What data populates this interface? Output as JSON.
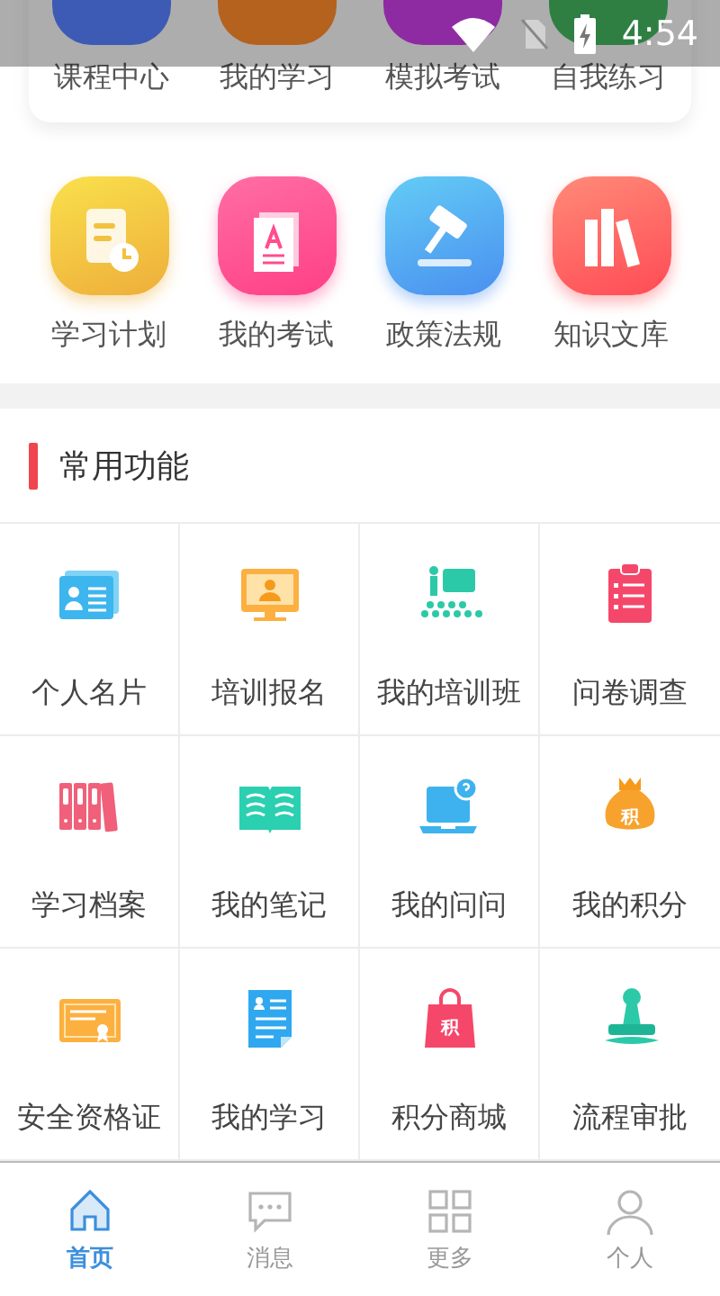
{
  "status_bar": {
    "time": "4:54"
  },
  "top_shortcuts": [
    {
      "label": "课程中心",
      "color": "#3d5bb5"
    },
    {
      "label": "我的学习",
      "color": "#b5621f"
    },
    {
      "label": "模拟考试",
      "color": "#8e2ba3"
    },
    {
      "label": "自我练习",
      "color": "#2f7f43"
    }
  ],
  "shortcuts": [
    {
      "label": "学习计划",
      "kind": "plan"
    },
    {
      "label": "我的考试",
      "kind": "exam"
    },
    {
      "label": "政策法规",
      "kind": "law"
    },
    {
      "label": "知识文库",
      "kind": "library"
    }
  ],
  "section": {
    "title": "常用功能"
  },
  "functions": [
    {
      "label": "个人名片",
      "kind": "card"
    },
    {
      "label": "培训报名",
      "kind": "monitor"
    },
    {
      "label": "我的培训班",
      "kind": "class"
    },
    {
      "label": "问卷调查",
      "kind": "survey"
    },
    {
      "label": "学习档案",
      "kind": "archive"
    },
    {
      "label": "我的笔记",
      "kind": "notes"
    },
    {
      "label": "我的问问",
      "kind": "qa"
    },
    {
      "label": "我的积分",
      "kind": "bag",
      "icon_text": "积"
    },
    {
      "label": "安全资格证",
      "kind": "certificate"
    },
    {
      "label": "我的学习",
      "kind": "doc"
    },
    {
      "label": "积分商城",
      "kind": "shop",
      "icon_text": "积"
    },
    {
      "label": "流程审批",
      "kind": "stamp"
    }
  ],
  "nav": [
    {
      "label": "首页",
      "kind": "home",
      "selected": true
    },
    {
      "label": "消息",
      "kind": "message",
      "selected": false
    },
    {
      "label": "更多",
      "kind": "grid",
      "selected": false
    },
    {
      "label": "个人",
      "kind": "person",
      "selected": false
    }
  ]
}
